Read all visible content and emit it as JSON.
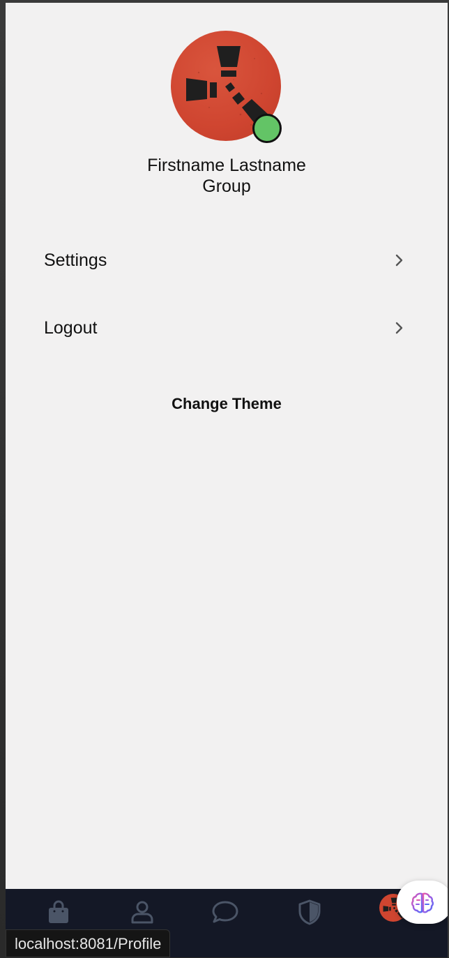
{
  "profile": {
    "name": "Firstname Lastname",
    "group": "Group",
    "status_color": "#63c466",
    "avatar_icon": "rust-logo-icon",
    "avatar_color": "#cf4530"
  },
  "menu": {
    "items": [
      {
        "label": "Settings",
        "icon": "chevron-right-icon"
      },
      {
        "label": "Logout",
        "icon": "chevron-right-icon"
      }
    ],
    "change_theme_label": "Change Theme"
  },
  "tabbar": {
    "background": "#141826",
    "icon_color": "#4b5567",
    "tabs": [
      {
        "icon": "shopping-bag-icon"
      },
      {
        "icon": "user-icon"
      },
      {
        "icon": "chat-bubble-icon"
      },
      {
        "icon": "shield-icon"
      },
      {
        "icon": "profile-avatar-icon",
        "active": true
      }
    ]
  },
  "assistant": {
    "icon": "brain-icon"
  },
  "status_bar": {
    "url": "localhost:8081/Profile"
  }
}
